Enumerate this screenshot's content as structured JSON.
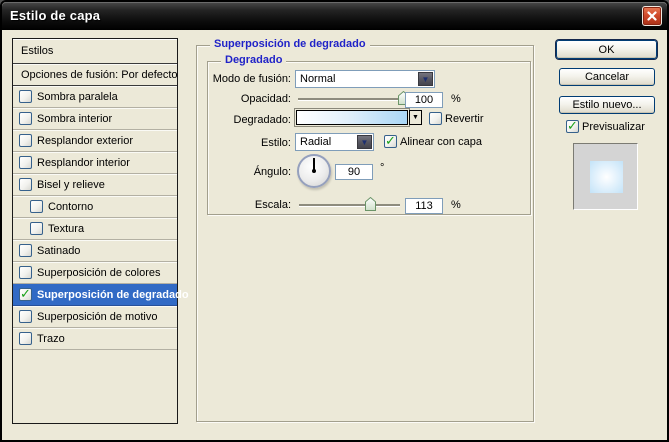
{
  "dialog": {
    "title": "Estilo de capa"
  },
  "sidebar": {
    "items": [
      {
        "label": "Estilos"
      },
      {
        "label": "Opciones de fusión: Por defecto"
      },
      {
        "label": "Sombra paralela",
        "checked": false
      },
      {
        "label": "Sombra interior",
        "checked": false
      },
      {
        "label": "Resplandor exterior",
        "checked": false
      },
      {
        "label": "Resplandor interior",
        "checked": false
      },
      {
        "label": "Bisel y relieve",
        "checked": false
      },
      {
        "label": "Contorno",
        "checked": false,
        "indented": true
      },
      {
        "label": "Textura",
        "checked": false,
        "indented": true
      },
      {
        "label": "Satinado",
        "checked": false
      },
      {
        "label": "Superposición de colores",
        "checked": false
      },
      {
        "label": "Superposición de degradado",
        "checked": true,
        "selected": true
      },
      {
        "label": "Superposición de motivo",
        "checked": false
      },
      {
        "label": "Trazo",
        "checked": false
      }
    ]
  },
  "panel": {
    "group_title": "Superposición de degradado",
    "inner_group_title": "Degradado",
    "blend_mode": {
      "label": "Modo de fusión:",
      "value": "Normal"
    },
    "opacity": {
      "label": "Opacidad:",
      "value": "100",
      "unit": "%"
    },
    "gradient": {
      "label": "Degradado:",
      "reverse_label": "Revertir",
      "reverse_checked": false
    },
    "style": {
      "label": "Estilo:",
      "value": "Radial",
      "align_label": "Alinear con capa",
      "align_checked": true
    },
    "angle": {
      "label": "Ángulo:",
      "value": "90",
      "unit": "°"
    },
    "scale": {
      "label": "Escala:",
      "value": "113",
      "unit": "%"
    }
  },
  "actions": {
    "ok": "OK",
    "cancel": "Cancelar",
    "new_style": "Estilo nuevo...",
    "preview_label": "Previsualizar",
    "preview_checked": true
  },
  "icons": {
    "close": "close-x",
    "dropdown_dark_arrow": "▼",
    "gradient_picker_arrow": "▼"
  },
  "colors": {
    "selection_blue": "#316ac5",
    "group_title_blue": "#2023c8",
    "dialog_background": "#ece9d8",
    "close_button_red": "#d14a2c",
    "check_green": "#19a119",
    "gradient_end_blue": "#a9d6f5"
  }
}
